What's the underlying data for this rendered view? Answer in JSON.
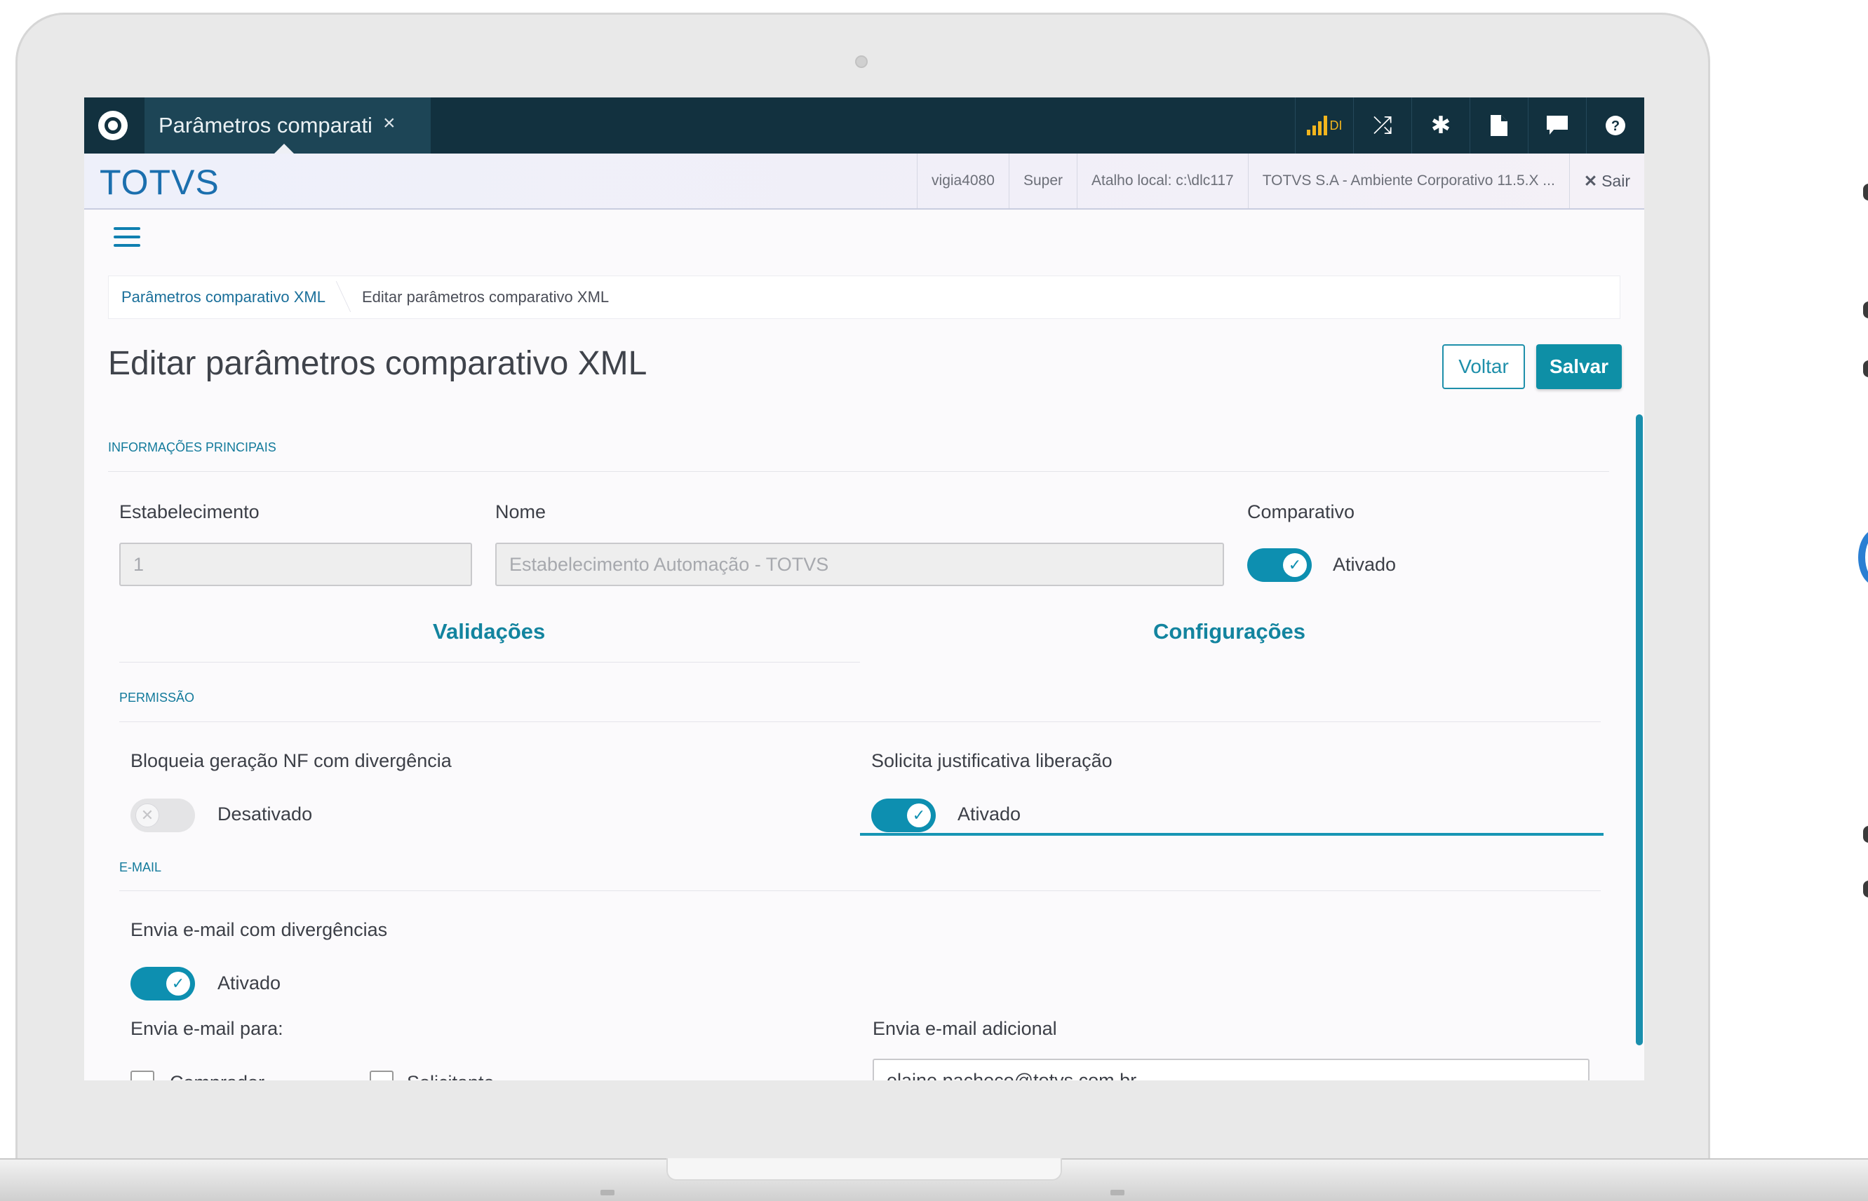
{
  "app": {
    "tab_title": "Parâmetros comparati",
    "tab_close": "×",
    "brand": "TOTVS",
    "topbar_icons": [
      "signal-di-icon",
      "shuffle-icon",
      "gear-icon",
      "document-icon",
      "chat-icon",
      "help-icon"
    ],
    "signal_label": "DI",
    "info": {
      "user": "vigia4080",
      "role": "Super",
      "shortcut": "Atalho local: c:\\dlc117",
      "environment": "TOTVS S.A - Ambiente Corporativo 11.5.X ...",
      "logout": "Sair"
    }
  },
  "breadcrumb": {
    "item1": "Parâmetros comparativo XML",
    "item2": "Editar parâmetros comparativo XML"
  },
  "page": {
    "title": "Editar parâmetros comparativo XML",
    "back_button": "Voltar",
    "save_button": "Salvar"
  },
  "main_info": {
    "section": "INFORMAÇÕES PRINCIPAIS",
    "estabelecimento_label": "Estabelecimento",
    "estabelecimento_value": "1",
    "nome_label": "Nome",
    "nome_value": "Estabelecimento Automação - TOTVS",
    "comparativo_label": "Comparativo",
    "comparativo_state": "Ativado"
  },
  "tabs": {
    "validacoes": "Validações",
    "configuracoes": "Configurações",
    "active": "configuracoes"
  },
  "permissao": {
    "section": "PERMISSÃO",
    "bloqueia_label": "Bloqueia geração NF com divergência",
    "bloqueia_state": "Desativado",
    "solicita_label": "Solicita justificativa liberação",
    "solicita_state": "Ativado"
  },
  "email": {
    "section": "E-MAIL",
    "envia_label": "Envia e-mail com divergências",
    "envia_state": "Ativado",
    "envia_para_label": "Envia e-mail para:",
    "recipient1": "Comprador",
    "recipient2": "Solicitante",
    "adicional_label": "Envia e-mail adicional",
    "adicional_value": "elaine.pacheco@totvs.com.br"
  },
  "colors": {
    "topbar": "#12313f",
    "accent": "#0e8fa6",
    "brand": "#1b6fae"
  }
}
